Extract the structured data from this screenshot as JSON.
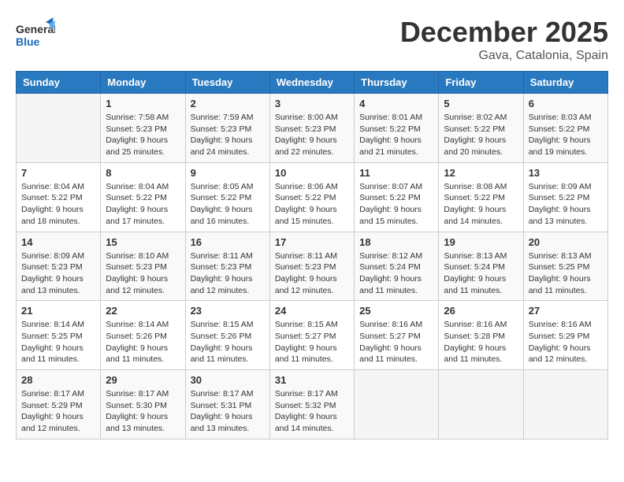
{
  "logo": {
    "general": "General",
    "blue": "Blue"
  },
  "title": "December 2025",
  "location": "Gava, Catalonia, Spain",
  "days_header": [
    "Sunday",
    "Monday",
    "Tuesday",
    "Wednesday",
    "Thursday",
    "Friday",
    "Saturday"
  ],
  "weeks": [
    [
      {
        "day": "",
        "sunrise": "",
        "sunset": "",
        "daylight": ""
      },
      {
        "day": "1",
        "sunrise": "Sunrise: 7:58 AM",
        "sunset": "Sunset: 5:23 PM",
        "daylight": "Daylight: 9 hours and 25 minutes."
      },
      {
        "day": "2",
        "sunrise": "Sunrise: 7:59 AM",
        "sunset": "Sunset: 5:23 PM",
        "daylight": "Daylight: 9 hours and 24 minutes."
      },
      {
        "day": "3",
        "sunrise": "Sunrise: 8:00 AM",
        "sunset": "Sunset: 5:23 PM",
        "daylight": "Daylight: 9 hours and 22 minutes."
      },
      {
        "day": "4",
        "sunrise": "Sunrise: 8:01 AM",
        "sunset": "Sunset: 5:22 PM",
        "daylight": "Daylight: 9 hours and 21 minutes."
      },
      {
        "day": "5",
        "sunrise": "Sunrise: 8:02 AM",
        "sunset": "Sunset: 5:22 PM",
        "daylight": "Daylight: 9 hours and 20 minutes."
      },
      {
        "day": "6",
        "sunrise": "Sunrise: 8:03 AM",
        "sunset": "Sunset: 5:22 PM",
        "daylight": "Daylight: 9 hours and 19 minutes."
      }
    ],
    [
      {
        "day": "7",
        "sunrise": "Sunrise: 8:04 AM",
        "sunset": "Sunset: 5:22 PM",
        "daylight": "Daylight: 9 hours and 18 minutes."
      },
      {
        "day": "8",
        "sunrise": "Sunrise: 8:04 AM",
        "sunset": "Sunset: 5:22 PM",
        "daylight": "Daylight: 9 hours and 17 minutes."
      },
      {
        "day": "9",
        "sunrise": "Sunrise: 8:05 AM",
        "sunset": "Sunset: 5:22 PM",
        "daylight": "Daylight: 9 hours and 16 minutes."
      },
      {
        "day": "10",
        "sunrise": "Sunrise: 8:06 AM",
        "sunset": "Sunset: 5:22 PM",
        "daylight": "Daylight: 9 hours and 15 minutes."
      },
      {
        "day": "11",
        "sunrise": "Sunrise: 8:07 AM",
        "sunset": "Sunset: 5:22 PM",
        "daylight": "Daylight: 9 hours and 15 minutes."
      },
      {
        "day": "12",
        "sunrise": "Sunrise: 8:08 AM",
        "sunset": "Sunset: 5:22 PM",
        "daylight": "Daylight: 9 hours and 14 minutes."
      },
      {
        "day": "13",
        "sunrise": "Sunrise: 8:09 AM",
        "sunset": "Sunset: 5:22 PM",
        "daylight": "Daylight: 9 hours and 13 minutes."
      }
    ],
    [
      {
        "day": "14",
        "sunrise": "Sunrise: 8:09 AM",
        "sunset": "Sunset: 5:23 PM",
        "daylight": "Daylight: 9 hours and 13 minutes."
      },
      {
        "day": "15",
        "sunrise": "Sunrise: 8:10 AM",
        "sunset": "Sunset: 5:23 PM",
        "daylight": "Daylight: 9 hours and 12 minutes."
      },
      {
        "day": "16",
        "sunrise": "Sunrise: 8:11 AM",
        "sunset": "Sunset: 5:23 PM",
        "daylight": "Daylight: 9 hours and 12 minutes."
      },
      {
        "day": "17",
        "sunrise": "Sunrise: 8:11 AM",
        "sunset": "Sunset: 5:23 PM",
        "daylight": "Daylight: 9 hours and 12 minutes."
      },
      {
        "day": "18",
        "sunrise": "Sunrise: 8:12 AM",
        "sunset": "Sunset: 5:24 PM",
        "daylight": "Daylight: 9 hours and 11 minutes."
      },
      {
        "day": "19",
        "sunrise": "Sunrise: 8:13 AM",
        "sunset": "Sunset: 5:24 PM",
        "daylight": "Daylight: 9 hours and 11 minutes."
      },
      {
        "day": "20",
        "sunrise": "Sunrise: 8:13 AM",
        "sunset": "Sunset: 5:25 PM",
        "daylight": "Daylight: 9 hours and 11 minutes."
      }
    ],
    [
      {
        "day": "21",
        "sunrise": "Sunrise: 8:14 AM",
        "sunset": "Sunset: 5:25 PM",
        "daylight": "Daylight: 9 hours and 11 minutes."
      },
      {
        "day": "22",
        "sunrise": "Sunrise: 8:14 AM",
        "sunset": "Sunset: 5:26 PM",
        "daylight": "Daylight: 9 hours and 11 minutes."
      },
      {
        "day": "23",
        "sunrise": "Sunrise: 8:15 AM",
        "sunset": "Sunset: 5:26 PM",
        "daylight": "Daylight: 9 hours and 11 minutes."
      },
      {
        "day": "24",
        "sunrise": "Sunrise: 8:15 AM",
        "sunset": "Sunset: 5:27 PM",
        "daylight": "Daylight: 9 hours and 11 minutes."
      },
      {
        "day": "25",
        "sunrise": "Sunrise: 8:16 AM",
        "sunset": "Sunset: 5:27 PM",
        "daylight": "Daylight: 9 hours and 11 minutes."
      },
      {
        "day": "26",
        "sunrise": "Sunrise: 8:16 AM",
        "sunset": "Sunset: 5:28 PM",
        "daylight": "Daylight: 9 hours and 11 minutes."
      },
      {
        "day": "27",
        "sunrise": "Sunrise: 8:16 AM",
        "sunset": "Sunset: 5:29 PM",
        "daylight": "Daylight: 9 hours and 12 minutes."
      }
    ],
    [
      {
        "day": "28",
        "sunrise": "Sunrise: 8:17 AM",
        "sunset": "Sunset: 5:29 PM",
        "daylight": "Daylight: 9 hours and 12 minutes."
      },
      {
        "day": "29",
        "sunrise": "Sunrise: 8:17 AM",
        "sunset": "Sunset: 5:30 PM",
        "daylight": "Daylight: 9 hours and 13 minutes."
      },
      {
        "day": "30",
        "sunrise": "Sunrise: 8:17 AM",
        "sunset": "Sunset: 5:31 PM",
        "daylight": "Daylight: 9 hours and 13 minutes."
      },
      {
        "day": "31",
        "sunrise": "Sunrise: 8:17 AM",
        "sunset": "Sunset: 5:32 PM",
        "daylight": "Daylight: 9 hours and 14 minutes."
      },
      {
        "day": "",
        "sunrise": "",
        "sunset": "",
        "daylight": ""
      },
      {
        "day": "",
        "sunrise": "",
        "sunset": "",
        "daylight": ""
      },
      {
        "day": "",
        "sunrise": "",
        "sunset": "",
        "daylight": ""
      }
    ]
  ]
}
